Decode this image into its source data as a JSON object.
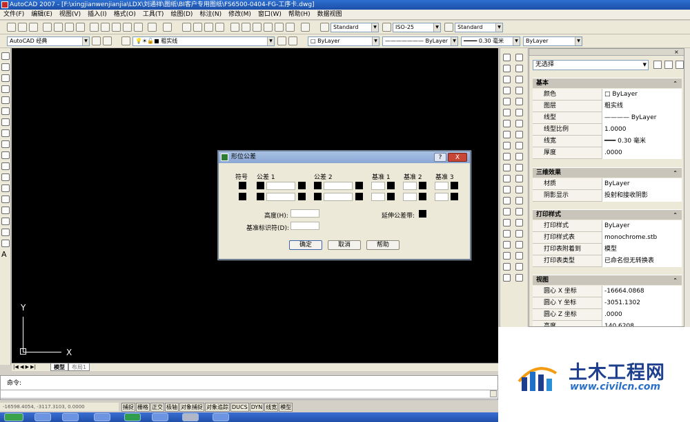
{
  "window": {
    "title": "AutoCAD 2007 - [F:\\xingjianwenjianjia\\LDX\\刘通祥\\图纸\\BI客户专用图纸\\FS6500-0404-FG-工序卡.dwg]"
  },
  "menu": [
    "文件(F)",
    "编辑(E)",
    "视图(V)",
    "插入(I)",
    "格式(O)",
    "工具(T)",
    "绘图(D)",
    "标注(N)",
    "修改(M)",
    "窗口(W)",
    "帮助(H)",
    "数据视图"
  ],
  "toolbar": {
    "text_style": "Standard",
    "dim_style": "ISO-25",
    "table_style": "Standard",
    "workspace": "AutoCAD 经典",
    "layer": "粗实线",
    "color": "ByLayer",
    "linetype": "ByLayer",
    "lineweight": "0.30 毫米",
    "plotstyle": "ByLayer"
  },
  "canvas": {
    "ucs_y": "Y",
    "ucs_x": "X"
  },
  "layout_tabs": [
    "模型",
    "布局1"
  ],
  "command": {
    "prompt": "命令:"
  },
  "coords": "-16598.4054, -3117.3103, 0.0000",
  "status_buttons": [
    "捕捉",
    "栅格",
    "正交",
    "极轴",
    "对象捕捉",
    "对象追踪",
    "DUCS",
    "DYN",
    "线宽",
    "模型"
  ],
  "properties": {
    "selection": "无选择",
    "sections": [
      {
        "title": "基本",
        "rows": [
          {
            "k": "颜色",
            "v": "□ ByLayer"
          },
          {
            "k": "图层",
            "v": "粗实线"
          },
          {
            "k": "线型",
            "v": "———— ByLayer"
          },
          {
            "k": "线型比例",
            "v": "1.0000"
          },
          {
            "k": "线宽",
            "v": "━━━ 0.30 毫米"
          },
          {
            "k": "厚度",
            "v": ".0000"
          }
        ]
      },
      {
        "title": "三维效果",
        "rows": [
          {
            "k": "材质",
            "v": "ByLayer"
          },
          {
            "k": "阴影显示",
            "v": "投射和接收阴影"
          }
        ]
      },
      {
        "title": "打印样式",
        "rows": [
          {
            "k": "打印样式",
            "v": "ByLayer"
          },
          {
            "k": "打印样式表",
            "v": "monochrome.stb"
          },
          {
            "k": "打印表附着到",
            "v": "模型"
          },
          {
            "k": "打印表类型",
            "v": "已命名但无转换表"
          }
        ]
      },
      {
        "title": "视图",
        "rows": [
          {
            "k": "圆心 X 坐标",
            "v": "-16664.0868"
          },
          {
            "k": "圆心 Y 坐标",
            "v": "-3051.1302"
          },
          {
            "k": "圆心 Z 坐标",
            "v": ".0000"
          },
          {
            "k": "高度",
            "v": "140.6208"
          }
        ]
      }
    ]
  },
  "dialog": {
    "title": "形位公差",
    "help": "?",
    "close": "X",
    "col_symbol": "符号",
    "col_tol1": "公差 1",
    "col_tol2": "公差 2",
    "col_datum1": "基准 1",
    "col_datum2": "基准 2",
    "col_datum3": "基准 3",
    "height_label": "高度(H):",
    "projected_label": "延伸公差带:",
    "datum_id_label": "基准标识符(D):",
    "ok": "确定",
    "cancel": "取消",
    "helpbtn": "帮助"
  },
  "watermark": {
    "name": "土木工程网",
    "url": "www.civilcn.com"
  }
}
